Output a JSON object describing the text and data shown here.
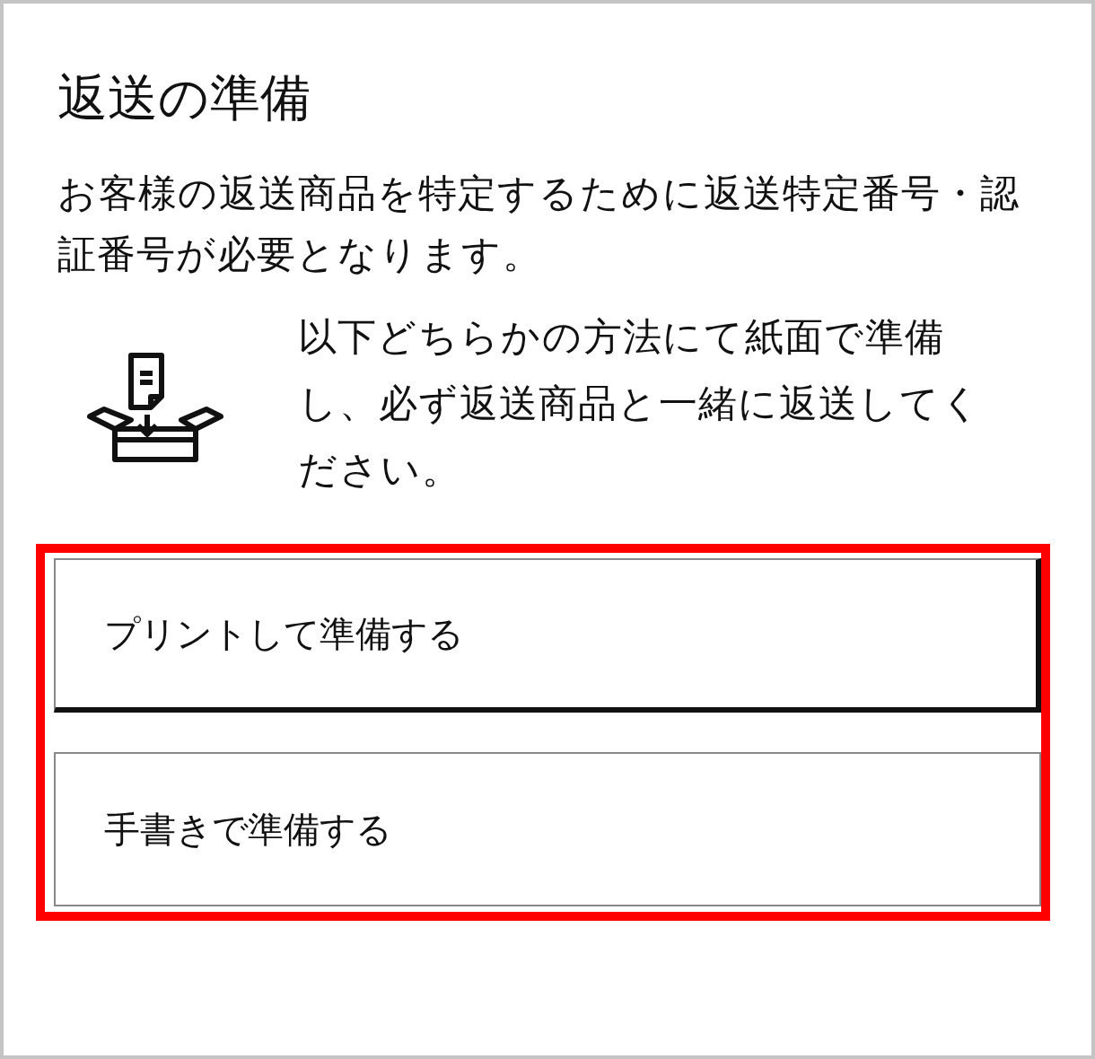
{
  "title": "返送の準備",
  "description": "お客様の返送商品を特定するために返送特定番号・認証番号が必要となります。",
  "instruction": "以下どちらかの方法にて紙面で準備し、必ず返送商品と一緒に返送してください。",
  "options": {
    "highlighted": true,
    "items": [
      {
        "label": "プリントして準備する",
        "focused": true
      },
      {
        "label": "手書きで準備する",
        "focused": false
      }
    ]
  }
}
